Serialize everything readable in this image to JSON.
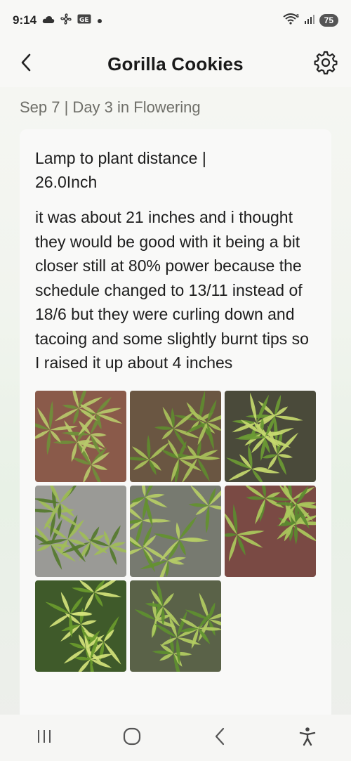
{
  "status_bar": {
    "time": "9:14",
    "battery": "75",
    "icons": [
      "cloud-icon",
      "fan-icon",
      "ge-badge-icon",
      "dot-icon",
      "wifi-icon",
      "signal-icon"
    ]
  },
  "header": {
    "title": "Gorilla Cookies",
    "back_icon": "chevron-left-icon",
    "settings_icon": "gear-icon"
  },
  "entry": {
    "date_line": "Sep 7 | Day 3 in Flowering",
    "title": "Lamp to plant distance | 26.0Inch",
    "body": "it was about 21 inches and i thought they would be good with it being a bit closer still at 80% power because the schedule changed to 13/11 instead of 18/6 but they were curling down and tacoing and some slightly burnt tips so I raised it up about 4 inches",
    "photos": [
      {
        "bg": "#8a5a4a",
        "leaf": "#6f8f3a",
        "hi": "#b7c96a"
      },
      {
        "bg": "#6a5642",
        "leaf": "#5f8a2f",
        "hi": "#a9c15a"
      },
      {
        "bg": "#4a4a3a",
        "leaf": "#6b9a34",
        "hi": "#c4d86e"
      },
      {
        "bg": "#9a9a96",
        "leaf": "#557a2c",
        "hi": "#9fbd57"
      },
      {
        "bg": "#777a70",
        "leaf": "#64912f",
        "hi": "#b6cd66"
      },
      {
        "bg": "#7a4a44",
        "leaf": "#5b8a30",
        "hi": "#aac95c"
      },
      {
        "bg": "#3f5a2a",
        "leaf": "#6a9b2c",
        "hi": "#d2e27a"
      },
      {
        "bg": "#5a6248",
        "leaf": "#5e8f30",
        "hi": "#b2cc62"
      }
    ]
  },
  "nav_bar": {
    "items": [
      "recent-apps-icon",
      "home-icon",
      "back-icon",
      "accessibility-icon"
    ]
  }
}
